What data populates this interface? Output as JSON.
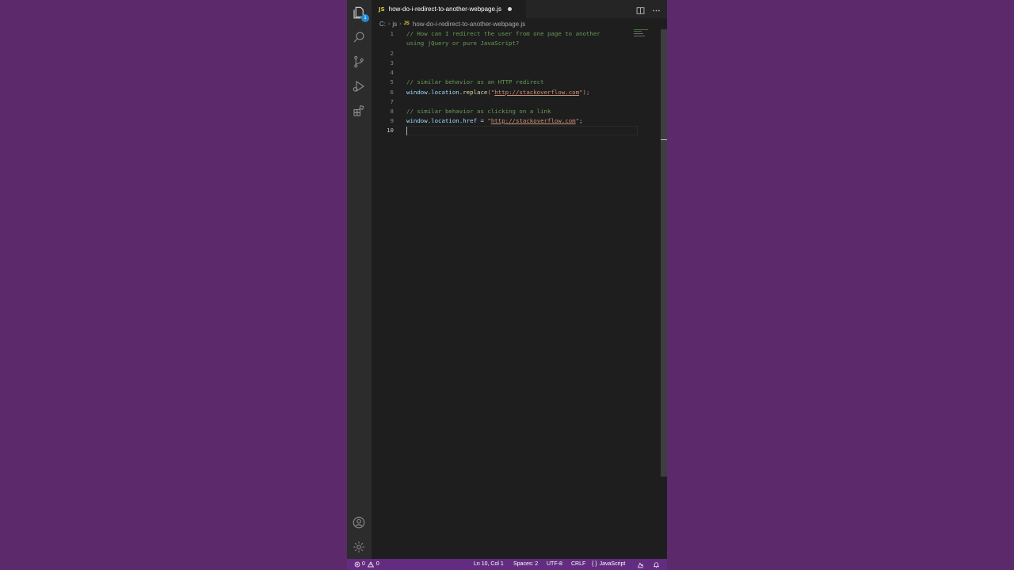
{
  "tab": {
    "file_type_badge": "JS",
    "title": "how-do-i-redirect-to-another-webpage.js",
    "dirty": true,
    "actions": [
      "split-editor-icon",
      "more-actions-icon"
    ]
  },
  "activity_bar": {
    "items": [
      "explorer-icon",
      "search-icon",
      "source-control-icon",
      "run-debug-icon",
      "extensions-icon"
    ],
    "explorer_badge": "1",
    "bottom": [
      "account-icon",
      "manage-gear-icon"
    ]
  },
  "breadcrumb": {
    "segments": [
      "C:",
      "js"
    ],
    "file_badge": "JS",
    "file": "how-do-i-redirect-to-another-webpage.js"
  },
  "editor": {
    "line_numbers": [
      "1",
      "2",
      "3",
      "4",
      "5",
      "6",
      "7",
      "8",
      "9",
      "10"
    ],
    "current_line": "10",
    "code": {
      "line1a": "// How can I redirect the user from one page to another",
      "line1b": "using jQuery or pure JavaScript?",
      "line5": "// similar behavior as an HTTP redirect",
      "line6_obj": "window",
      "line6_dot1": ".",
      "line6_prop": "location",
      "line6_dot2": ".",
      "line6_fn": "replace",
      "line6_open": "(\"",
      "line6_url": "http://stackoverflow.com",
      "line6_close": "\");",
      "line8": "// similar behavior as clicking on a link",
      "line9_obj": "window",
      "line9_dot1": ".",
      "line9_prop": "location",
      "line9_dot2": ".",
      "line9_prop2": "href",
      "line9_eq": " = ",
      "line9_q1": "\"",
      "line9_url": "http://stackoverflow.com",
      "line9_q2": "\"",
      "line9_semi": ";"
    }
  },
  "status_bar": {
    "errors": "0",
    "warnings": "0",
    "position": "Ln 10, Col 1",
    "spaces": "Spaces: 2",
    "encoding": "UTF-8",
    "eol": "CRLF",
    "language_braces": "{ }",
    "language": "JavaScript"
  },
  "colors": {
    "background": "#5c2a6b",
    "status_bar": "#642c80",
    "editor_bg": "#1e1e1e",
    "comment": "#6a9955",
    "string": "#ce9178",
    "variable": "#9cdcfe",
    "function": "#dcdcaa"
  }
}
